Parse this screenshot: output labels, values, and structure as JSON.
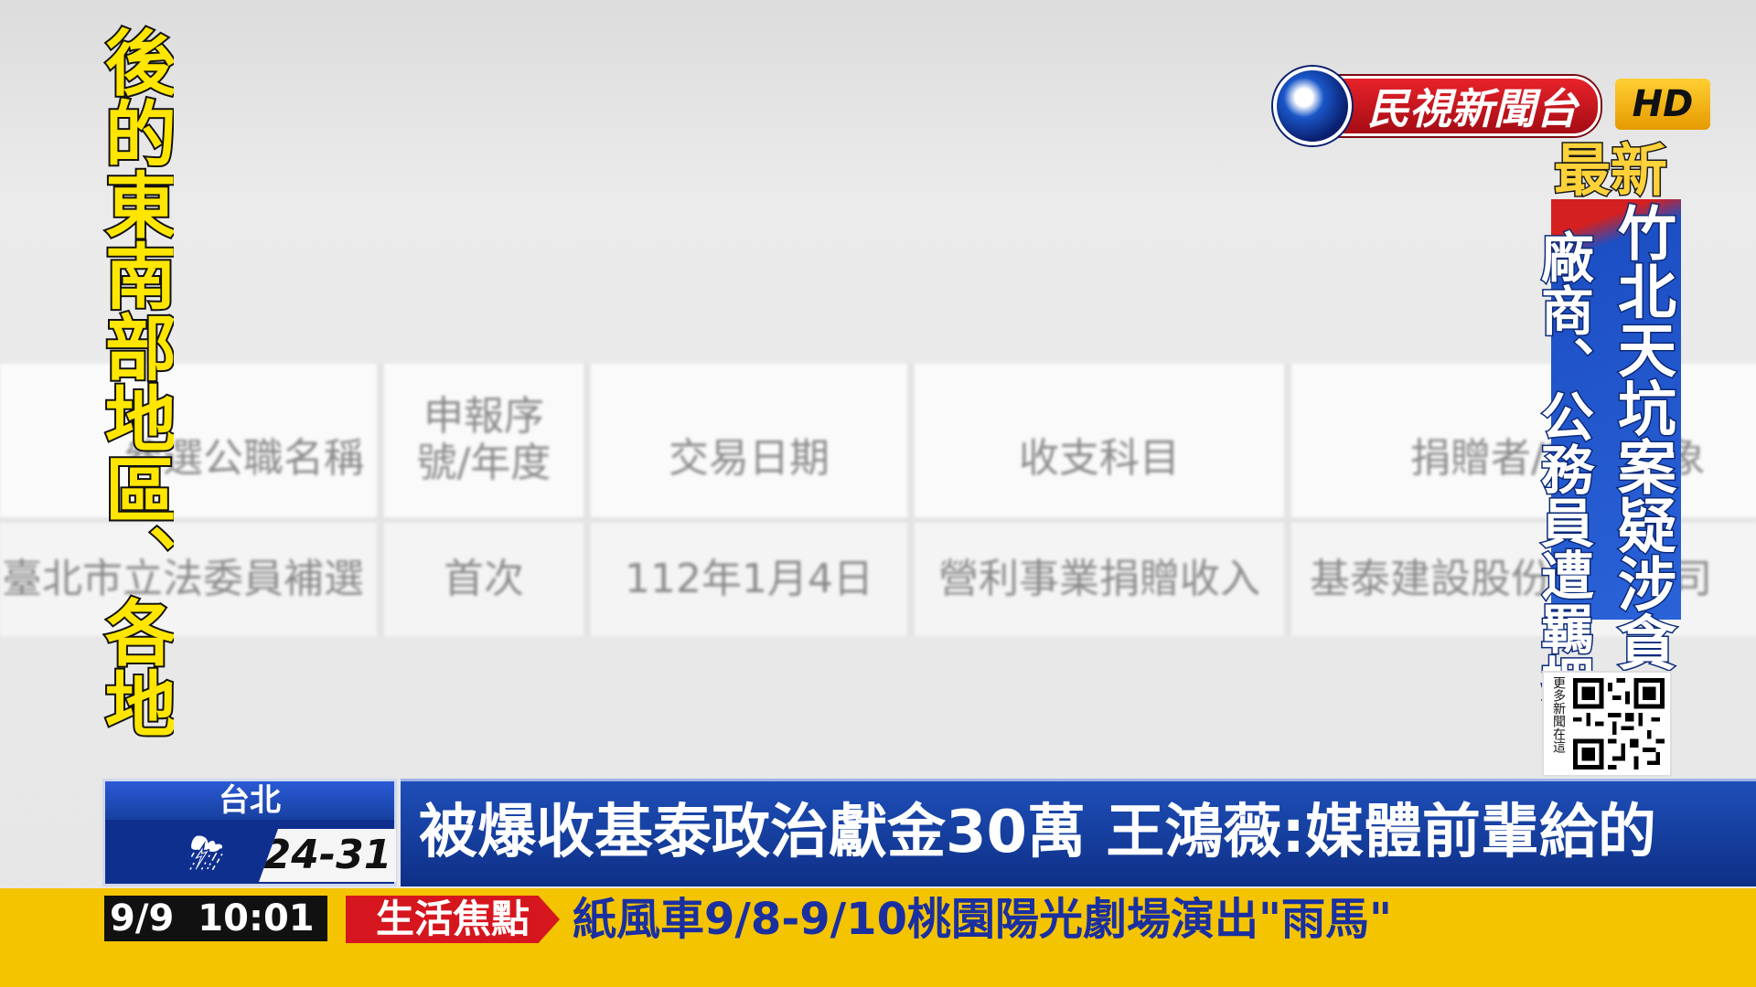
{
  "channel": {
    "name": "民視新聞台",
    "quality": "HD"
  },
  "left_vertical_text": "後的東南部地區、各地",
  "background_table": {
    "headers": [
      "參選公職名稱",
      "申報序號/年度",
      "交易日期",
      "收支科目",
      "捐贈者/支出對象"
    ],
    "row": [
      "臺北市立法委員補選",
      "首次",
      "112年1月4日",
      "營利事業捐贈收入",
      "基泰建設股份有限公司"
    ]
  },
  "breaking": {
    "label": "最新",
    "line1": "竹北天坑案疑涉貪",
    "line2": "廠商、公務員遭羈押"
  },
  "qr": {
    "caption": "更多新聞在這"
  },
  "weather": {
    "city": "台北",
    "icon": "thunderstorm-icon",
    "temp_range": "24-31"
  },
  "headline": "被爆收基泰政治獻金30萬 王鴻薇:媒體前輩給的",
  "ticker": {
    "date": "9/9",
    "time": "10:01",
    "tag": "生活焦點",
    "text": "紙風車9/8-9/10桃園陽光劇場演出\"雨馬\""
  },
  "colors": {
    "brand_red": "#d6161e",
    "headline_blue": "#0e2f86",
    "ticker_yellow": "#f5c400",
    "subtitle_yellow": "#ffe600"
  }
}
